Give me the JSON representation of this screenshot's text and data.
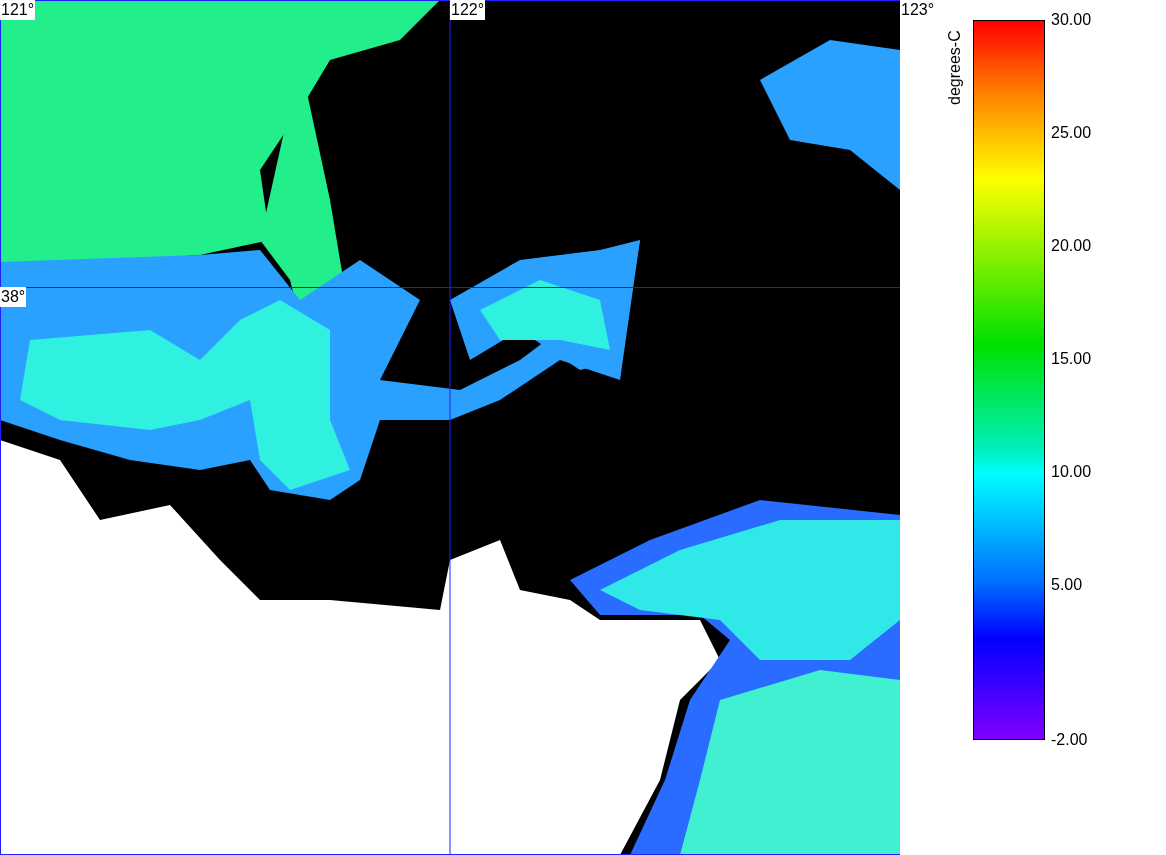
{
  "map": {
    "lon_labels": [
      "121°",
      "122°",
      "123°"
    ],
    "lat_labels": [
      "38°"
    ]
  },
  "colorbar": {
    "title": "degrees-C",
    "ticks": [
      "30.00",
      "25.00",
      "20.00",
      "15.00",
      "10.00",
      "5.00",
      "-2.00"
    ]
  }
}
